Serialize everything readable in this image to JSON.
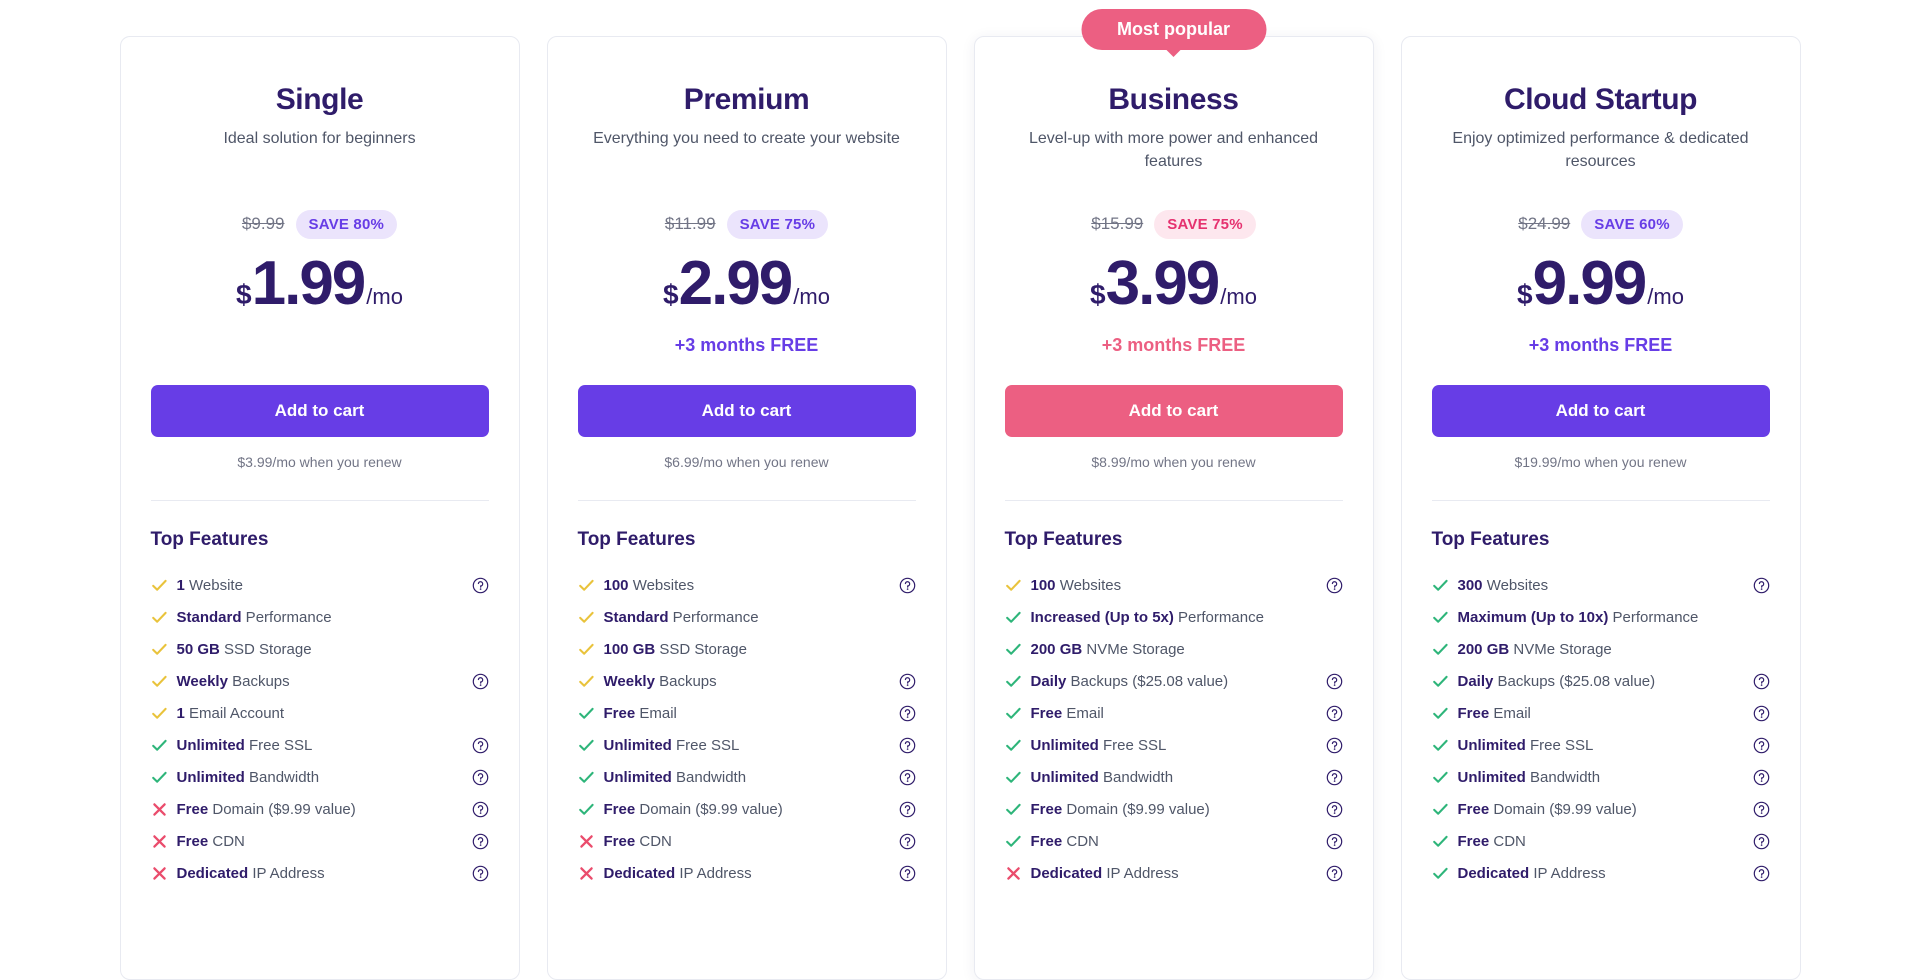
{
  "colors": {
    "violet": "#673de6",
    "pink": "#ec5f82",
    "heading": "#2f1c6a",
    "body": "#4f5668",
    "muted": "#727586",
    "check_green": "#2eb57a",
    "check_yellow": "#e9c33c",
    "cross_red": "#ea4c6c"
  },
  "popular_badge": "Most popular",
  "plans": [
    {
      "name": "Single",
      "description": "Ideal solution for beginners",
      "old_price": "$9.99",
      "save_label": "SAVE 80%",
      "save_style": "violet",
      "currency": "$",
      "price": "1.99",
      "period": "/mo",
      "free_months": "",
      "cta_label": "Add to cart",
      "cta_style": "violet",
      "renew_note": "$3.99/mo when you renew",
      "features_title": "Top Features",
      "featured": false,
      "features": [
        {
          "mark": "check-yellow",
          "bold": "1",
          "rest": " Website",
          "help": true
        },
        {
          "mark": "check-yellow",
          "bold": "Standard",
          "rest": " Performance",
          "help": false
        },
        {
          "mark": "check-yellow",
          "bold": "50 GB",
          "rest": " SSD Storage",
          "help": false
        },
        {
          "mark": "check-yellow",
          "bold": "Weekly",
          "rest": " Backups",
          "help": true
        },
        {
          "mark": "check-yellow",
          "bold": "1",
          "rest": " Email Account",
          "help": false
        },
        {
          "mark": "check-green",
          "bold": "Unlimited",
          "rest": " Free SSL",
          "help": true
        },
        {
          "mark": "check-green",
          "bold": "Unlimited",
          "rest": " Bandwidth",
          "help": true
        },
        {
          "mark": "cross",
          "bold": "Free",
          "rest": " Domain ($9.99 value)",
          "help": true
        },
        {
          "mark": "cross",
          "bold": "Free",
          "rest": " CDN",
          "help": true
        },
        {
          "mark": "cross",
          "bold": "Dedicated",
          "rest": " IP Address",
          "help": true
        }
      ]
    },
    {
      "name": "Premium",
      "description": "Everything you need to create your website",
      "old_price": "$11.99",
      "save_label": "SAVE 75%",
      "save_style": "violet",
      "currency": "$",
      "price": "2.99",
      "period": "/mo",
      "free_months": "+3 months FREE",
      "free_style": "violet",
      "cta_label": "Add to cart",
      "cta_style": "violet",
      "renew_note": "$6.99/mo when you renew",
      "features_title": "Top Features",
      "featured": false,
      "features": [
        {
          "mark": "check-yellow",
          "bold": "100",
          "rest": " Websites",
          "help": true
        },
        {
          "mark": "check-yellow",
          "bold": "Standard",
          "rest": " Performance",
          "help": false
        },
        {
          "mark": "check-yellow",
          "bold": "100 GB",
          "rest": " SSD Storage",
          "help": false
        },
        {
          "mark": "check-yellow",
          "bold": "Weekly",
          "rest": " Backups",
          "help": true
        },
        {
          "mark": "check-green",
          "bold": "Free",
          "rest": " Email",
          "help": true
        },
        {
          "mark": "check-green",
          "bold": "Unlimited",
          "rest": " Free SSL",
          "help": true
        },
        {
          "mark": "check-green",
          "bold": "Unlimited",
          "rest": " Bandwidth",
          "help": true
        },
        {
          "mark": "check-green",
          "bold": "Free",
          "rest": " Domain ($9.99 value)",
          "help": true
        },
        {
          "mark": "cross",
          "bold": "Free",
          "rest": " CDN",
          "help": true
        },
        {
          "mark": "cross",
          "bold": "Dedicated",
          "rest": " IP Address",
          "help": true
        }
      ]
    },
    {
      "name": "Business",
      "description": "Level-up with more power and enhanced features",
      "old_price": "$15.99",
      "save_label": "SAVE 75%",
      "save_style": "pink",
      "currency": "$",
      "price": "3.99",
      "period": "/mo",
      "free_months": "+3 months FREE",
      "free_style": "pink",
      "cta_label": "Add to cart",
      "cta_style": "pink",
      "renew_note": "$8.99/mo when you renew",
      "features_title": "Top Features",
      "featured": true,
      "features": [
        {
          "mark": "check-yellow",
          "bold": "100",
          "rest": " Websites",
          "help": true
        },
        {
          "mark": "check-green",
          "bold": "Increased (Up to 5x)",
          "rest": " Performance",
          "help": false
        },
        {
          "mark": "check-green",
          "bold": "200 GB",
          "rest": " NVMe Storage",
          "help": false
        },
        {
          "mark": "check-green",
          "bold": "Daily",
          "rest": " Backups ($25.08 value)",
          "help": true
        },
        {
          "mark": "check-green",
          "bold": "Free",
          "rest": " Email",
          "help": true
        },
        {
          "mark": "check-green",
          "bold": "Unlimited",
          "rest": " Free SSL",
          "help": true
        },
        {
          "mark": "check-green",
          "bold": "Unlimited",
          "rest": " Bandwidth",
          "help": true
        },
        {
          "mark": "check-green",
          "bold": "Free",
          "rest": " Domain ($9.99 value)",
          "help": true
        },
        {
          "mark": "check-green",
          "bold": "Free",
          "rest": " CDN",
          "help": true
        },
        {
          "mark": "cross",
          "bold": "Dedicated",
          "rest": " IP Address",
          "help": true
        }
      ]
    },
    {
      "name": "Cloud Startup",
      "description": "Enjoy optimized performance & dedicated resources",
      "old_price": "$24.99",
      "save_label": "SAVE 60%",
      "save_style": "violet",
      "currency": "$",
      "price": "9.99",
      "period": "/mo",
      "free_months": "+3 months FREE",
      "free_style": "violet",
      "cta_label": "Add to cart",
      "cta_style": "violet",
      "renew_note": "$19.99/mo when you renew",
      "features_title": "Top Features",
      "featured": false,
      "features": [
        {
          "mark": "check-green",
          "bold": "300",
          "rest": " Websites",
          "help": true
        },
        {
          "mark": "check-green",
          "bold": "Maximum (Up to 10x)",
          "rest": " Performance",
          "help": false
        },
        {
          "mark": "check-green",
          "bold": "200 GB",
          "rest": " NVMe Storage",
          "help": false
        },
        {
          "mark": "check-green",
          "bold": "Daily",
          "rest": " Backups ($25.08 value)",
          "help": true
        },
        {
          "mark": "check-green",
          "bold": "Free",
          "rest": " Email",
          "help": true
        },
        {
          "mark": "check-green",
          "bold": "Unlimited",
          "rest": " Free SSL",
          "help": true
        },
        {
          "mark": "check-green",
          "bold": "Unlimited",
          "rest": " Bandwidth",
          "help": true
        },
        {
          "mark": "check-green",
          "bold": "Free",
          "rest": " Domain ($9.99 value)",
          "help": true
        },
        {
          "mark": "check-green",
          "bold": "Free",
          "rest": " CDN",
          "help": true
        },
        {
          "mark": "check-green",
          "bold": "Dedicated",
          "rest": " IP Address",
          "help": true
        }
      ]
    }
  ]
}
